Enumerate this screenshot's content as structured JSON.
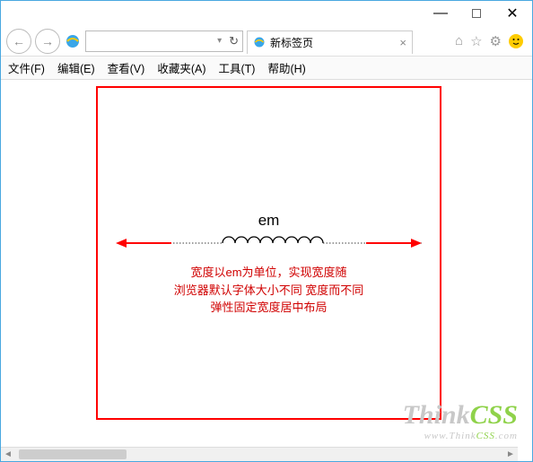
{
  "window": {
    "minimize": "—",
    "maximize": "",
    "close": "✕"
  },
  "nav": {
    "back": "←",
    "forward": "→",
    "address_placeholder": "",
    "dropdown": "▾",
    "refresh": "↻",
    "tab_title": "新标签页",
    "tab_close": "×"
  },
  "toolbar_icons": {
    "home": "⌂",
    "favorite": "☆",
    "settings": "⚙",
    "feedback": "☺"
  },
  "menu": {
    "file": "文件(F)",
    "edit": "编辑(E)",
    "view": "查看(V)",
    "favorites": "收藏夹(A)",
    "tools": "工具(T)",
    "help": "帮助(H)"
  },
  "content": {
    "label": "em",
    "desc_line1": "宽度以em为单位，实现宽度随",
    "desc_line2": "浏览器默认字体大小不同 宽度而不同",
    "desc_line3": "弹性固定宽度居中布局"
  },
  "watermark": {
    "brand_think": "Think",
    "brand_css": "CSS",
    "url_prefix": "www.",
    "url_think": "Think",
    "url_css": "CSS",
    "url_suffix": ".com"
  }
}
